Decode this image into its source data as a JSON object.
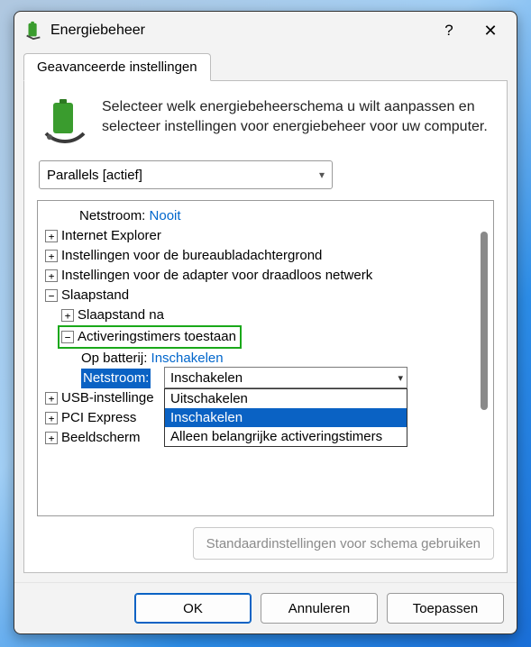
{
  "window": {
    "title": "Energiebeheer"
  },
  "tab": {
    "label": "Geavanceerde instellingen"
  },
  "intro": {
    "text": "Selecteer welk energiebeheerschema u wilt aanpassen en selecteer instellingen voor energiebeheer voor uw computer."
  },
  "scheme": {
    "selected": "Parallels [actief]"
  },
  "tree": {
    "netstroom_label": "Netstroom:",
    "netstroom_value": "Nooit",
    "items": {
      "ie": "Internet Explorer",
      "desktop_bg": "Instellingen voor de bureaubladachtergrond",
      "wireless": "Instellingen voor de adapter voor draadloos netwerk",
      "sleep": "Slaapstand",
      "sleep_after": "Slaapstand na",
      "wake_timers": "Activeringstimers toestaan",
      "on_battery_label": "Op batterij:",
      "on_battery_value": "Inschakelen",
      "on_ac_label": "Netstroom:",
      "on_ac_value": "Inschakelen",
      "usb": "USB-instellinge",
      "pci": "PCI Express",
      "display": "Beeldscherm"
    }
  },
  "combo": {
    "current": "Inschakelen",
    "options": [
      "Uitschakelen",
      "Inschakelen",
      "Alleen belangrijke activeringstimers"
    ]
  },
  "restore": "Standaardinstellingen voor schema gebruiken",
  "buttons": {
    "ok": "OK",
    "cancel": "Annuleren",
    "apply": "Toepassen"
  }
}
